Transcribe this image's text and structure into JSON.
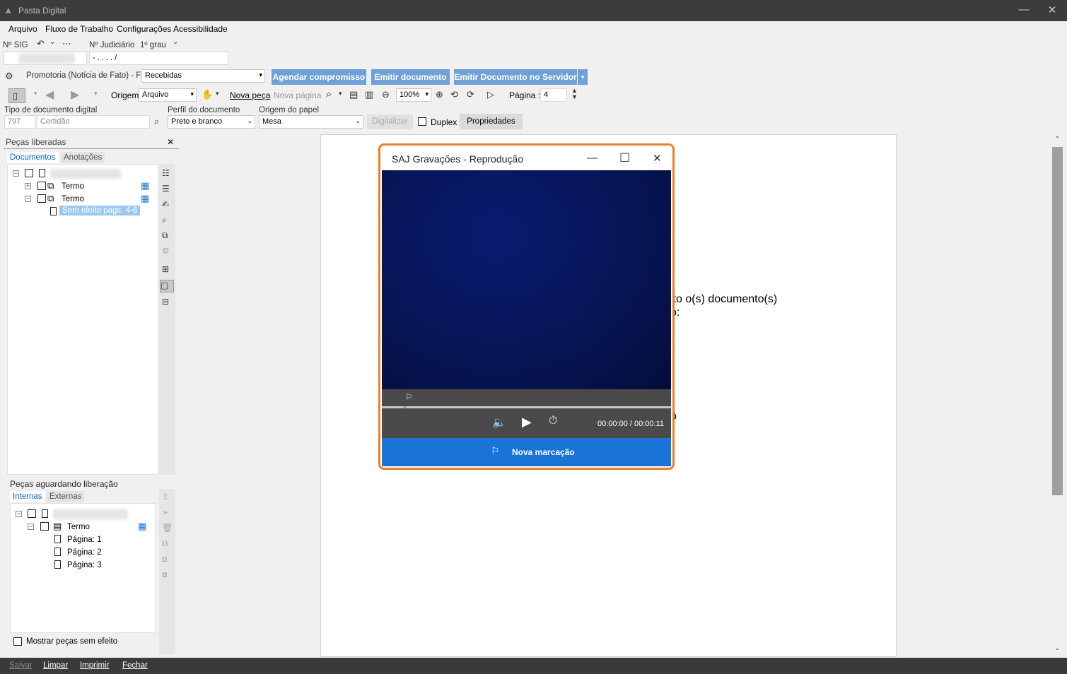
{
  "window": {
    "title": "Pasta Digital",
    "minimize": "—",
    "close": "✕"
  },
  "menu": [
    "Arquivo",
    "Fluxo de Trabalho",
    "Configurações",
    "Acessibilidade"
  ],
  "header": {
    "sig_label": "Nº SIG",
    "judiciario_label": "Nº Judiciário",
    "grau": "1º grau",
    "judiciario_value": "-  .    .  .  .    /",
    "fila_label": "Promotoria (Notícia de Fato) - Fila",
    "fila_value": "Recebidas"
  },
  "actions": {
    "agendar": "Agendar compromisso",
    "emitir": "Emitir documento",
    "emitir_servidor": "Emitir Documento no Servidor"
  },
  "toolbar": {
    "origem_label": "Origem",
    "origem_value": "Arquivo",
    "nova_peca": "Nova peça",
    "nova_pagina": "Nova página",
    "zoom": "100%",
    "pagina_label": "Página :",
    "pagina_value": "4"
  },
  "digital": {
    "tipo_label": "Tipo de documento digital",
    "tipo_code": "797",
    "tipo_name": "Certidão",
    "perfil_label": "Perfil do documento",
    "perfil_value": "Preto e branco",
    "origem_papel_label": "Origem do papel",
    "origem_papel_value": "Mesa",
    "digitalizar": "Digitalizar",
    "duplex": "Duplex",
    "propriedades": "Propriedades"
  },
  "pecas_liberadas": {
    "title": "Peças liberadas",
    "close": "✕",
    "tabs": [
      "Documentos",
      "Anotações"
    ],
    "items": [
      "Termo",
      "Termo",
      "Sem efeito pags. 4-6"
    ]
  },
  "pecas_aguardando": {
    "title": "Peças aguardando liberação",
    "tabs": [
      "Internas",
      "Externas"
    ],
    "items": [
      "Termo",
      "Página: 1",
      "Página: 2",
      "Página: 3"
    ],
    "mostrar": "Mostrar peças sem efeito"
  },
  "document": {
    "line1": "ito o(s) documento(s)",
    "line2": "o:",
    "line3": "ô"
  },
  "player": {
    "title": "SAJ Gravações - Reprodução",
    "time": "00:00:00 / 00:00:11",
    "nova_marcacao": "Nova marcação",
    "progress": 0.0
  },
  "footer": [
    "Salvar",
    "Limpar",
    "Imprimir",
    "Fechar"
  ],
  "colors": {
    "accent": "#6fa0d8",
    "player_border": "#e8822a",
    "player_button": "#1a73d6"
  }
}
